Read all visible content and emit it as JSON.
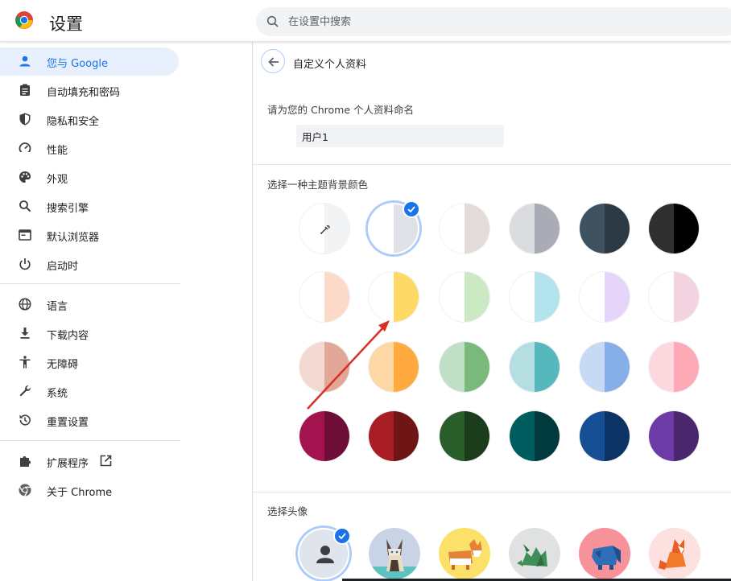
{
  "app": {
    "title": "设置"
  },
  "search": {
    "placeholder": "在设置中搜索"
  },
  "sidebar": {
    "items": [
      {
        "label": "您与 Google",
        "icon": "person-icon",
        "active": true
      },
      {
        "label": "自动填充和密码",
        "icon": "clipboard-icon"
      },
      {
        "label": "隐私和安全",
        "icon": "shield-icon"
      },
      {
        "label": "性能",
        "icon": "speedometer-icon"
      },
      {
        "label": "外观",
        "icon": "palette-icon"
      },
      {
        "label": "搜索引擎",
        "icon": "search-icon"
      },
      {
        "label": "默认浏览器",
        "icon": "browser-window-icon"
      },
      {
        "label": "启动时",
        "icon": "power-icon"
      },
      {
        "label": "语言",
        "icon": "globe-icon"
      },
      {
        "label": "下载内容",
        "icon": "download-icon"
      },
      {
        "label": "无障碍",
        "icon": "accessibility-icon"
      },
      {
        "label": "系统",
        "icon": "wrench-icon"
      },
      {
        "label": "重置设置",
        "icon": "restore-icon"
      },
      {
        "label": "扩展程序",
        "icon": "puzzle-icon"
      },
      {
        "label": "关于 Chrome",
        "icon": "chrome-icon"
      }
    ]
  },
  "main": {
    "page_title": "自定义个人资料",
    "name_label": "请为您的 Chrome 个人资料命名",
    "name_value": "用户1",
    "theme_label": "选择一种主题背景颜色",
    "avatar_label": "选择头像",
    "colors": {
      "accent": "#1a73e8",
      "selected_ring": "#aecbfa",
      "annotation_arrow": "#d93025"
    },
    "theme_swatches": [
      [
        [
          "#ffffff",
          "#f1f3f4",
          "custom-color-picker"
        ],
        [
          "#ffffff",
          "#dee1e6",
          "default",
          "selected"
        ],
        [
          "#ffffff",
          "#e3dbd9"
        ],
        [
          "#dadce0",
          "#a9acb5"
        ],
        [
          "#3e5261",
          "#2c3a45"
        ],
        [
          "#303030",
          "#000000"
        ]
      ],
      [
        [
          "#ffffff",
          "#fddac8"
        ],
        [
          "#ffffff",
          "#ffd966"
        ],
        [
          "#ffffff",
          "#cbeac4"
        ],
        [
          "#ffffff",
          "#b3e4ed"
        ],
        [
          "#ffffff",
          "#e6d5fb"
        ],
        [
          "#ffffff",
          "#f4d3e0"
        ]
      ],
      [
        [
          "#f3d9d4",
          "#e2a797"
        ],
        [
          "#fdd8a6",
          "#ffa93f"
        ],
        [
          "#c1dfc4",
          "#79b97b"
        ],
        [
          "#b4dedf",
          "#56b8bd"
        ],
        [
          "#c6d9f5",
          "#86aee8"
        ],
        [
          "#fdd9df",
          "#fda9b6"
        ]
      ],
      [
        [
          "#a3144f",
          "#6e0e37"
        ],
        [
          "#a81d23",
          "#701515"
        ],
        [
          "#295e2b",
          "#1b3d1c"
        ],
        [
          "#005d5f",
          "#003a3d"
        ],
        [
          "#164f94",
          "#0d3364"
        ],
        [
          "#6c3ba6",
          "#4a266e"
        ]
      ]
    ],
    "avatars": [
      {
        "name": "generic-person-avatar",
        "selected": true
      },
      {
        "name": "origami-cat-avatar"
      },
      {
        "name": "origami-corgi-avatar"
      },
      {
        "name": "origami-dragon-avatar"
      },
      {
        "name": "origami-elephant-avatar"
      },
      {
        "name": "origami-fox-avatar"
      }
    ]
  }
}
